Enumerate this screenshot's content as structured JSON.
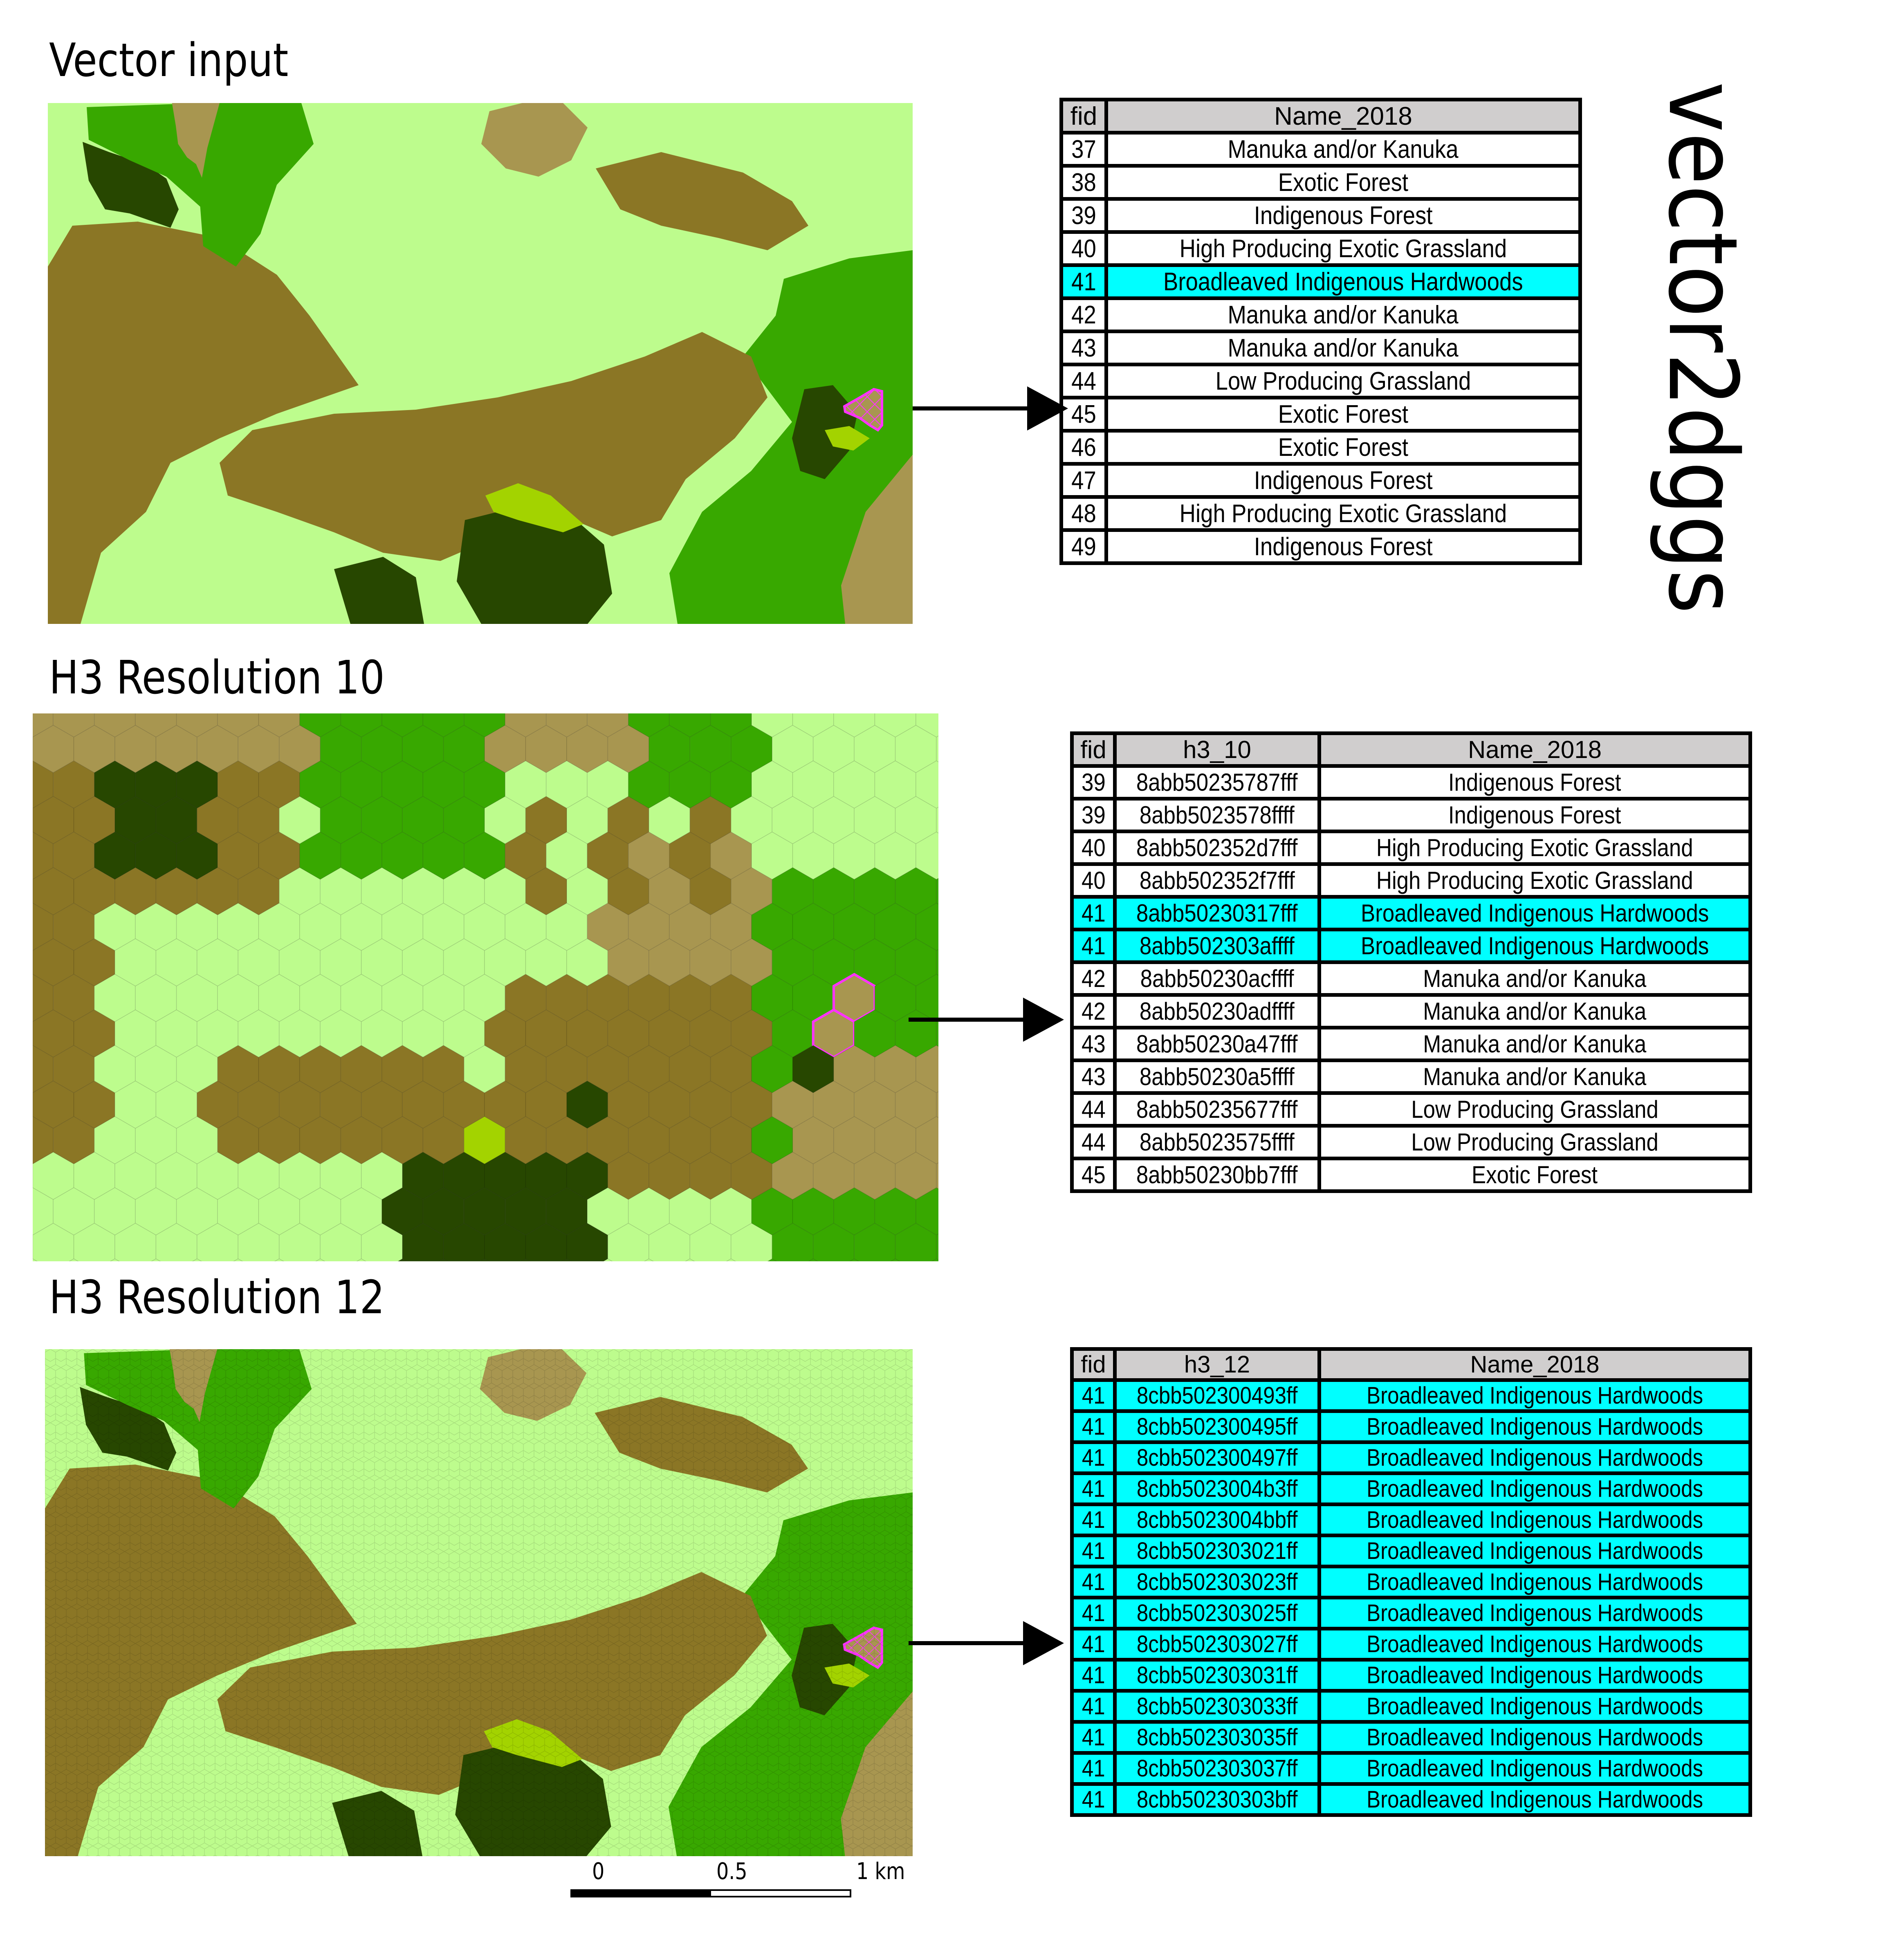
{
  "figure": {
    "side_label": "vector2dggs",
    "colors": {
      "low_producing_grassland": "#bdfc8d",
      "olive": "#8b7625",
      "tan": "#a89650",
      "exotic_forest": "#38a800",
      "indigenous_forest": "#274700",
      "lime": "#a3d300",
      "highlight_outline": "#ff33ff",
      "table_highlight": "#00ffff",
      "table_header": "#d0cece"
    }
  },
  "panels": [
    {
      "title": "Vector input",
      "table": {
        "columns": [
          "fid",
          "Name_2018"
        ],
        "rows": [
          {
            "fid": "37",
            "name": "Manuka and/or Kanuka",
            "highlight": false
          },
          {
            "fid": "38",
            "name": "Exotic Forest",
            "highlight": false
          },
          {
            "fid": "39",
            "name": "Indigenous Forest",
            "highlight": false
          },
          {
            "fid": "40",
            "name": "High Producing Exotic Grassland",
            "highlight": false
          },
          {
            "fid": "41",
            "name": "Broadleaved Indigenous Hardwoods",
            "highlight": true
          },
          {
            "fid": "42",
            "name": "Manuka and/or Kanuka",
            "highlight": false
          },
          {
            "fid": "43",
            "name": "Manuka and/or Kanuka",
            "highlight": false
          },
          {
            "fid": "44",
            "name": "Low Producing Grassland",
            "highlight": false
          },
          {
            "fid": "45",
            "name": "Exotic Forest",
            "highlight": false
          },
          {
            "fid": "46",
            "name": "Exotic Forest",
            "highlight": false
          },
          {
            "fid": "47",
            "name": "Indigenous Forest",
            "highlight": false
          },
          {
            "fid": "48",
            "name": "High Producing Exotic Grassland",
            "highlight": false
          },
          {
            "fid": "49",
            "name": "Indigenous Forest",
            "highlight": false
          }
        ]
      }
    },
    {
      "title": "H3 Resolution 10",
      "table": {
        "columns": [
          "fid",
          "h3_10",
          "Name_2018"
        ],
        "rows": [
          {
            "fid": "39",
            "h3": "8abb50235787fff",
            "name": "Indigenous Forest",
            "highlight": false
          },
          {
            "fid": "39",
            "h3": "8abb5023578ffff",
            "name": "Indigenous Forest",
            "highlight": false
          },
          {
            "fid": "40",
            "h3": "8abb502352d7fff",
            "name": "High Producing Exotic Grassland",
            "highlight": false
          },
          {
            "fid": "40",
            "h3": "8abb502352f7fff",
            "name": "High Producing Exotic Grassland",
            "highlight": false
          },
          {
            "fid": "41",
            "h3": "8abb50230317fff",
            "name": "Broadleaved Indigenous Hardwoods",
            "highlight": true
          },
          {
            "fid": "41",
            "h3": "8abb502303affff",
            "name": "Broadleaved Indigenous Hardwoods",
            "highlight": true
          },
          {
            "fid": "42",
            "h3": "8abb50230acffff",
            "name": "Manuka and/or Kanuka",
            "highlight": false
          },
          {
            "fid": "42",
            "h3": "8abb50230adffff",
            "name": "Manuka and/or Kanuka",
            "highlight": false
          },
          {
            "fid": "43",
            "h3": "8abb50230a47fff",
            "name": "Manuka and/or Kanuka",
            "highlight": false
          },
          {
            "fid": "43",
            "h3": "8abb50230a5ffff",
            "name": "Manuka and/or Kanuka",
            "highlight": false
          },
          {
            "fid": "44",
            "h3": "8abb50235677fff",
            "name": "Low Producing Grassland",
            "highlight": false
          },
          {
            "fid": "44",
            "h3": "8abb5023575ffff",
            "name": "Low Producing Grassland",
            "highlight": false
          },
          {
            "fid": "45",
            "h3": "8abb50230bb7fff",
            "name": "Exotic Forest",
            "highlight": false
          }
        ]
      }
    },
    {
      "title": "H3 Resolution 12",
      "table": {
        "columns": [
          "fid",
          "h3_12",
          "Name_2018"
        ],
        "rows": [
          {
            "fid": "41",
            "h3": "8cbb502300493ff",
            "name": "Broadleaved Indigenous Hardwoods",
            "highlight": true
          },
          {
            "fid": "41",
            "h3": "8cbb502300495ff",
            "name": "Broadleaved Indigenous Hardwoods",
            "highlight": true
          },
          {
            "fid": "41",
            "h3": "8cbb502300497ff",
            "name": "Broadleaved Indigenous Hardwoods",
            "highlight": true
          },
          {
            "fid": "41",
            "h3": "8cbb5023004b3ff",
            "name": "Broadleaved Indigenous Hardwoods",
            "highlight": true
          },
          {
            "fid": "41",
            "h3": "8cbb5023004bbff",
            "name": "Broadleaved Indigenous Hardwoods",
            "highlight": true
          },
          {
            "fid": "41",
            "h3": "8cbb502303021ff",
            "name": "Broadleaved Indigenous Hardwoods",
            "highlight": true
          },
          {
            "fid": "41",
            "h3": "8cbb502303023ff",
            "name": "Broadleaved Indigenous Hardwoods",
            "highlight": true
          },
          {
            "fid": "41",
            "h3": "8cbb502303025ff",
            "name": "Broadleaved Indigenous Hardwoods",
            "highlight": true
          },
          {
            "fid": "41",
            "h3": "8cbb502303027ff",
            "name": "Broadleaved Indigenous Hardwoods",
            "highlight": true
          },
          {
            "fid": "41",
            "h3": "8cbb502303031ff",
            "name": "Broadleaved Indigenous Hardwoods",
            "highlight": true
          },
          {
            "fid": "41",
            "h3": "8cbb502303033ff",
            "name": "Broadleaved Indigenous Hardwoods",
            "highlight": true
          },
          {
            "fid": "41",
            "h3": "8cbb502303035ff",
            "name": "Broadleaved Indigenous Hardwoods",
            "highlight": true
          },
          {
            "fid": "41",
            "h3": "8cbb502303037ff",
            "name": "Broadleaved Indigenous Hardwoods",
            "highlight": true
          },
          {
            "fid": "41",
            "h3": "8cbb50230303bff",
            "name": "Broadleaved Indigenous Hardwoods",
            "highlight": true
          }
        ]
      }
    }
  ],
  "scale_bar": {
    "labels": [
      "0",
      "0.5",
      "1 km"
    ]
  }
}
